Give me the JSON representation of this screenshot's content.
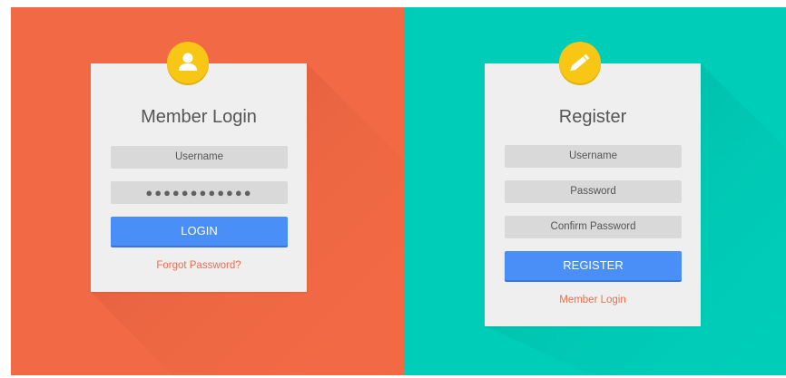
{
  "colors": {
    "left_background": "#f26a45",
    "right_background": "#00cdb8",
    "card_background": "#efefef",
    "field_background": "#d9d9d9",
    "button_blue": "#4a8ff7",
    "link_orange": "#f26c4a",
    "badge_yellow": "#f8c614"
  },
  "login": {
    "icon": "user-icon",
    "title": "Member Login",
    "username_placeholder": "Username",
    "password_value": "●●●●●●●●●●●●",
    "button_label": "LOGIN",
    "forgot_link": "Forgot Password?"
  },
  "register": {
    "icon": "pencil-icon",
    "title": "Register",
    "username_placeholder": "Username",
    "password_placeholder": "Password",
    "confirm_placeholder": "Confirm Password",
    "button_label": "REGISTER",
    "member_login_link": "Member Login"
  }
}
